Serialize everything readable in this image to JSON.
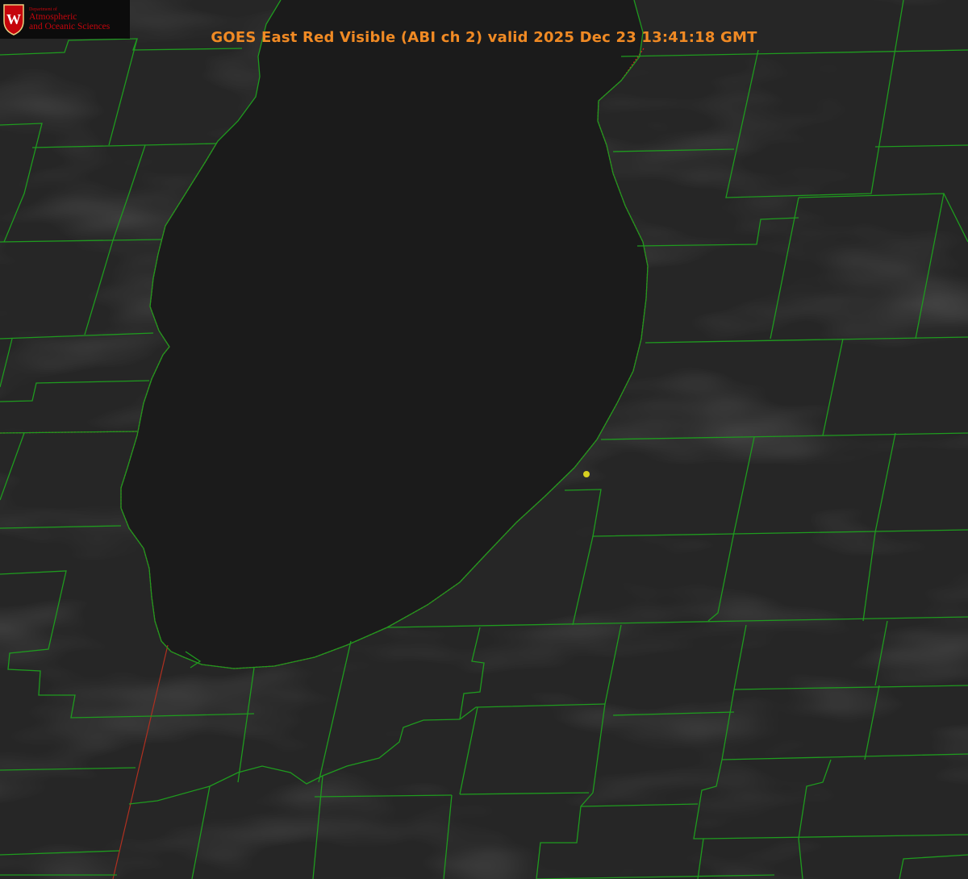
{
  "title": "GOES East Red Visible (ABI ch 2) valid 2025 Dec 23 13:41:18 GMT",
  "logo": {
    "department": "Department of",
    "line1": "Atmospheric",
    "line2": "and Oceanic Sciences",
    "crest_letter": "W"
  },
  "colors": {
    "background": "#262626",
    "lake": "#1a1a1a",
    "county_borders": "#1f9b1f",
    "state_border": "#d42020",
    "title": "#f08a24",
    "marker": "#d8d020",
    "logo_red": "#c5050c"
  },
  "icons": {
    "crest": "university-crest-icon",
    "marker": "station-marker-icon"
  }
}
